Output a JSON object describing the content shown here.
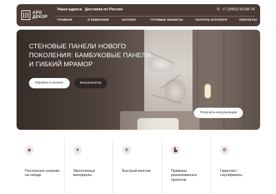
{
  "header": {
    "logo_line1": "АРО",
    "logo_line2": "ДЕКОР",
    "top_links": [
      "Наши адреса",
      "Доставка по России"
    ],
    "phone": "+7 (3452) 53-58-74",
    "phone_icon": "phone-icon",
    "nav": [
      "ГЛАВНАЯ",
      "О КОМПАНИИ",
      "КАТАЛОГ",
      "ГОТОВЫЕ ОБЪЕКТЫ",
      "СКАЧАТЬ КАТАЛОГИ",
      "КОНТАКТЫ"
    ]
  },
  "hero": {
    "title_line1": "СТЕНОВЫЕ ПАНЕЛИ НОВОГО",
    "title_line2": "ПОКОЛЕНИЯ: БАМБУКОВЫЕ ПАНЕЛИ",
    "title_line3": "И ГИБКИЙ МРАМОР",
    "catalog_button": "Перейти в каталог",
    "visualizer_button": "Визуализатор",
    "consult_button": "Получить консультацию"
  },
  "features": [
    {
      "icon": "warehouse-icon",
      "glyph": "◉",
      "label": "Постоянное наличие на складе"
    },
    {
      "icon": "eco-leaf-icon",
      "glyph": "❦",
      "label": "Экологичные материалы"
    },
    {
      "icon": "tools-icon",
      "glyph": "⚙",
      "label": "Быстрый монтаж"
    },
    {
      "icon": "building-icon",
      "glyph": "▙",
      "label": "Примеры реализованных проектов"
    },
    {
      "icon": "certificate-icon",
      "glyph": "✪",
      "label": "Гарантии / сертификаты"
    }
  ],
  "colors": {
    "header_bg": "#4a3b36",
    "accent": "#6a3a33",
    "dark_button": "#2f2724"
  }
}
